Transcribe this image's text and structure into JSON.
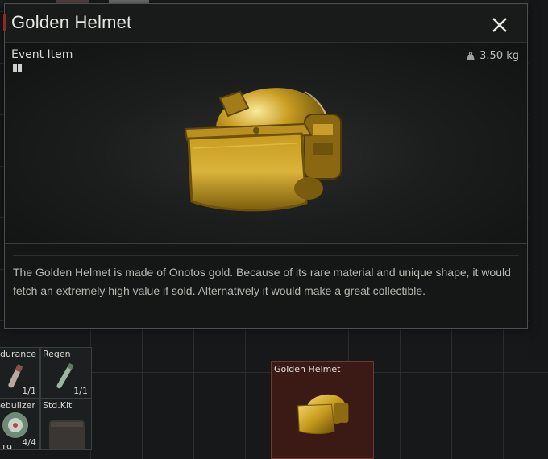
{
  "modal": {
    "title": "Golden Helmet",
    "category": "Event Item",
    "weight": "3.50 kg",
    "description": "The Golden Helmet is made of Onotos gold. Because of its rare material and unique shape, it would fetch an extremely high value if sold. Alternatively it would make a great collectible."
  },
  "inventory": {
    "cells": [
      {
        "name": "durance",
        "count": "1/1"
      },
      {
        "name": "Regen",
        "count": "1/1"
      },
      {
        "name": "ebulizer",
        "count": "4/4",
        "extra": "19"
      },
      {
        "name": "Std.Kit",
        "count": ""
      }
    ],
    "selected_item": {
      "name": "Golden Helmet"
    }
  },
  "colors": {
    "accent": "#8a2a22",
    "gold": "#c9a21e",
    "selected_cell": "#3b1a16"
  },
  "icons": [
    "close-icon",
    "grid-icon",
    "weight-icon",
    "helmet-icon"
  ]
}
